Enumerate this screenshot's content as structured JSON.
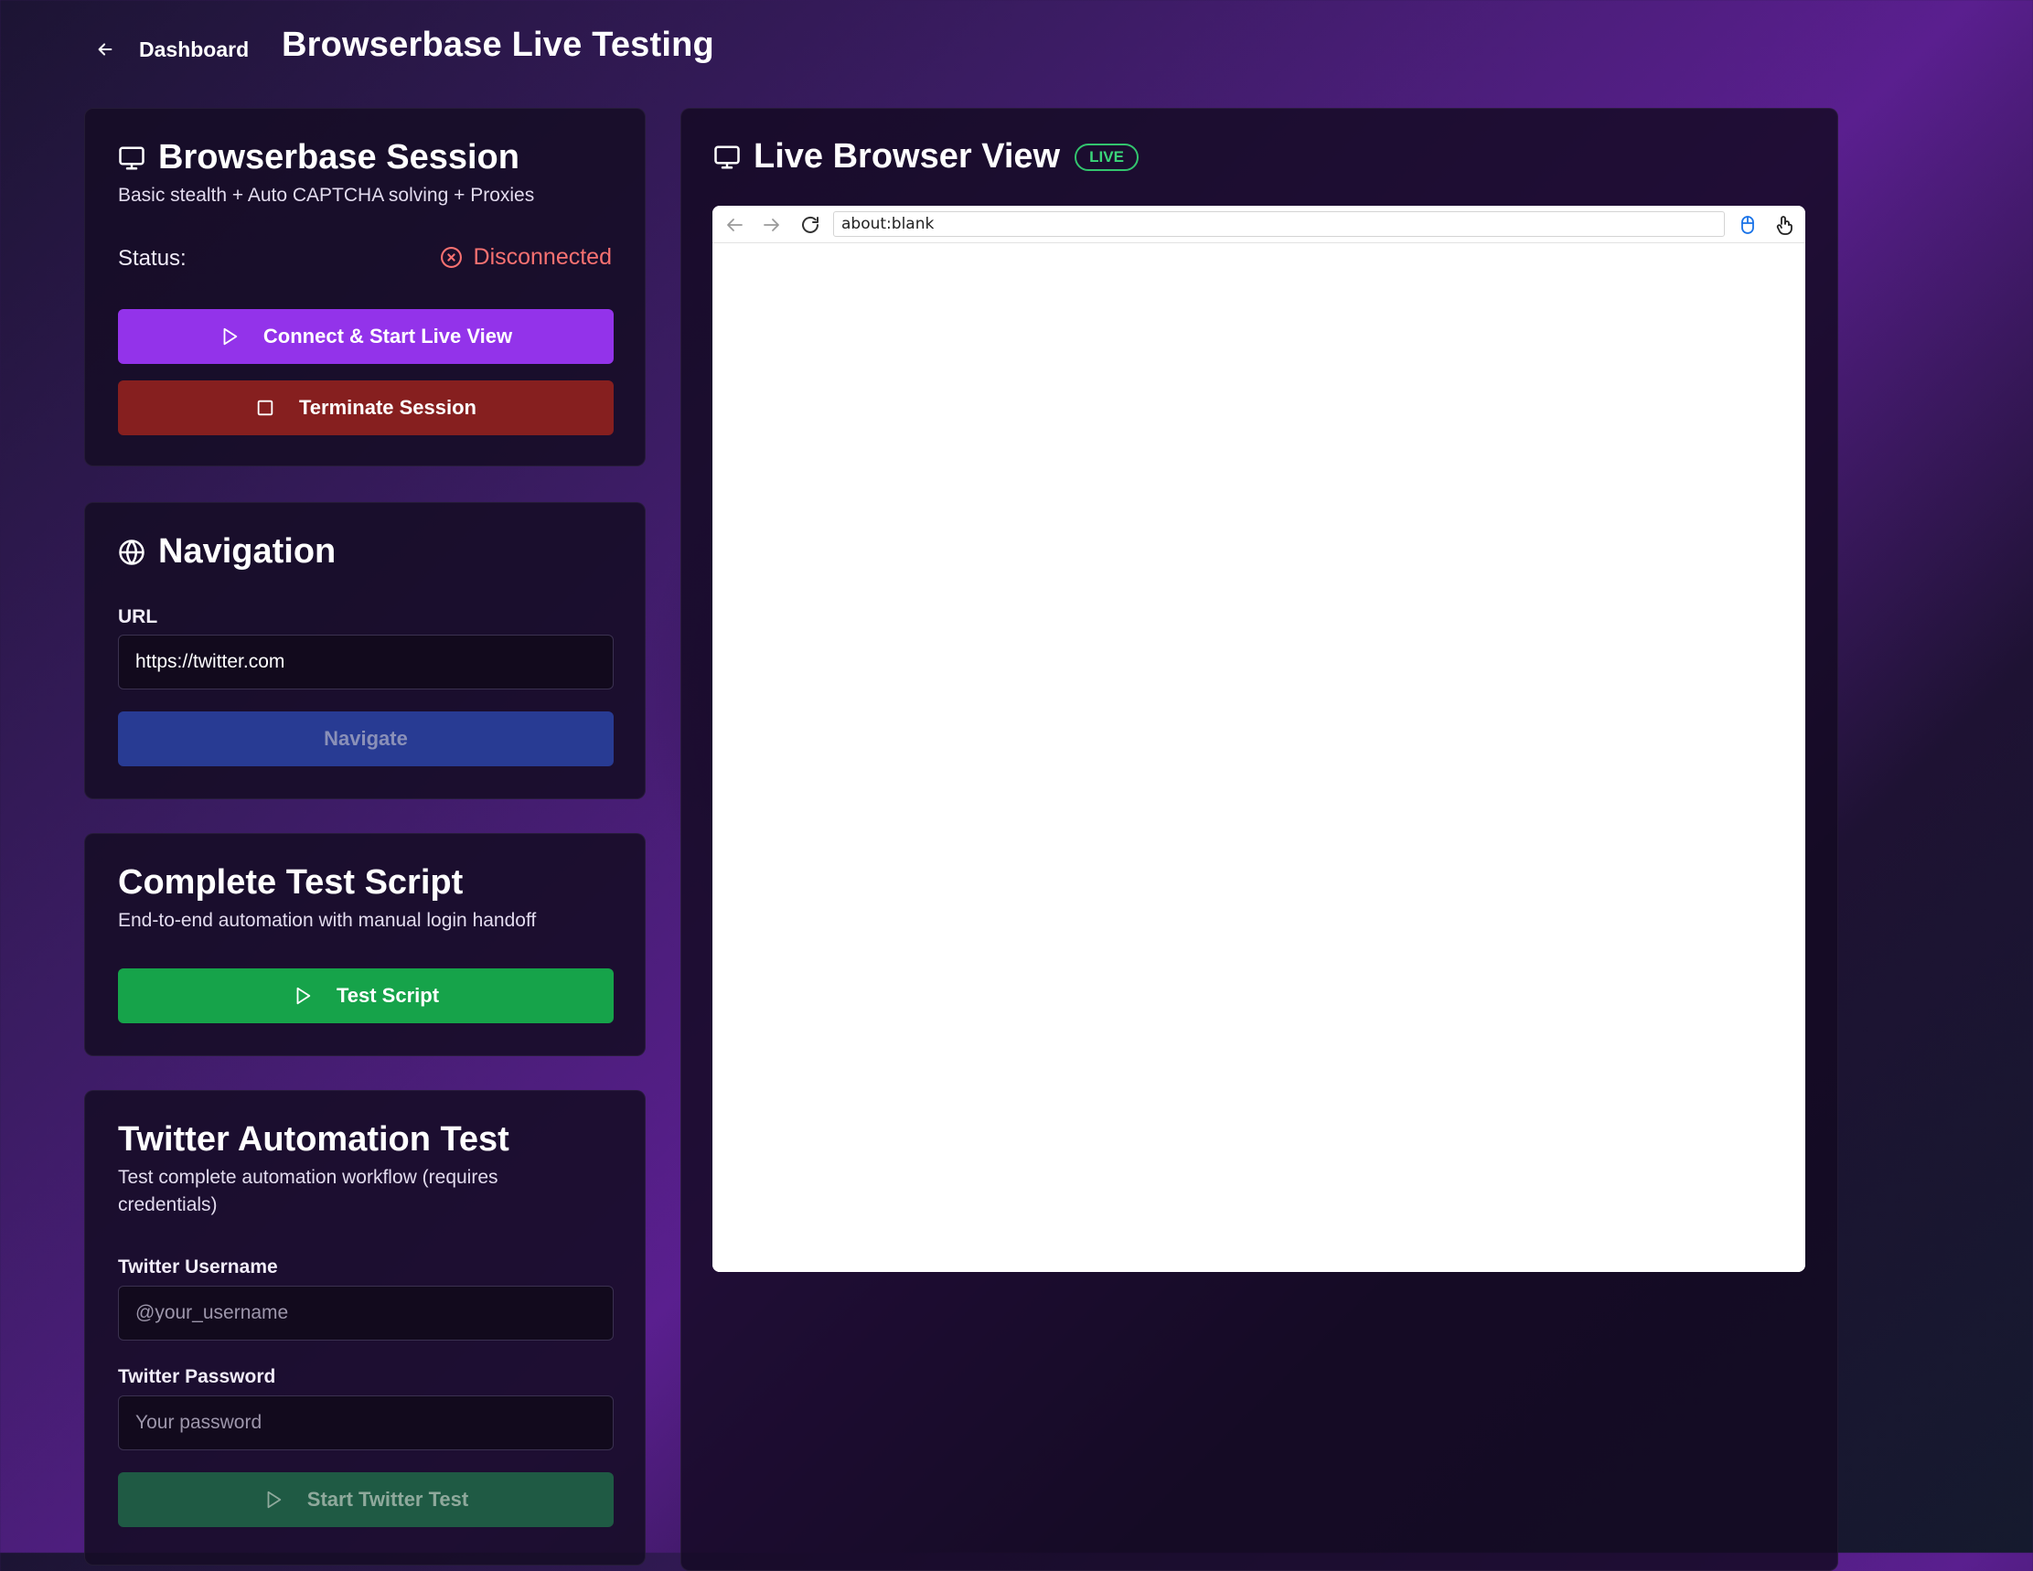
{
  "header": {
    "back_label": "Dashboard",
    "title": "Browserbase Live Testing"
  },
  "session": {
    "title": "Browserbase Session",
    "subtitle": "Basic stealth + Auto CAPTCHA solving + Proxies",
    "status_label": "Status:",
    "status_value": "Disconnected",
    "status_color": "#f87171",
    "connect_button": "Connect & Start Live View",
    "connect_color": "#9333ea",
    "terminate_button": "Terminate Session",
    "terminate_color": "#861f1f"
  },
  "navigation": {
    "title": "Navigation",
    "url_label": "URL",
    "url_value": "https://twitter.com",
    "navigate_button": "Navigate",
    "navigate_color": "#283b93"
  },
  "test_script": {
    "title": "Complete Test Script",
    "subtitle": "End-to-end automation with manual login handoff",
    "button": "Test Script",
    "button_color": "#16a34a"
  },
  "twitter": {
    "title": "Twitter Automation Test",
    "subtitle": "Test complete automation workflow (requires credentials)",
    "username_label": "Twitter Username",
    "username_placeholder": "@your_username",
    "password_label": "Twitter Password",
    "password_placeholder": "Your password",
    "start_button": "Start Twitter Test",
    "start_color": "#1f5a44"
  },
  "browser_view": {
    "title": "Live Browser View",
    "badge": "LIVE",
    "address": "about:blank",
    "icons": [
      "back-arrow-icon",
      "forward-arrow-icon",
      "reload-icon",
      "mouse-icon",
      "touch-icon"
    ]
  }
}
